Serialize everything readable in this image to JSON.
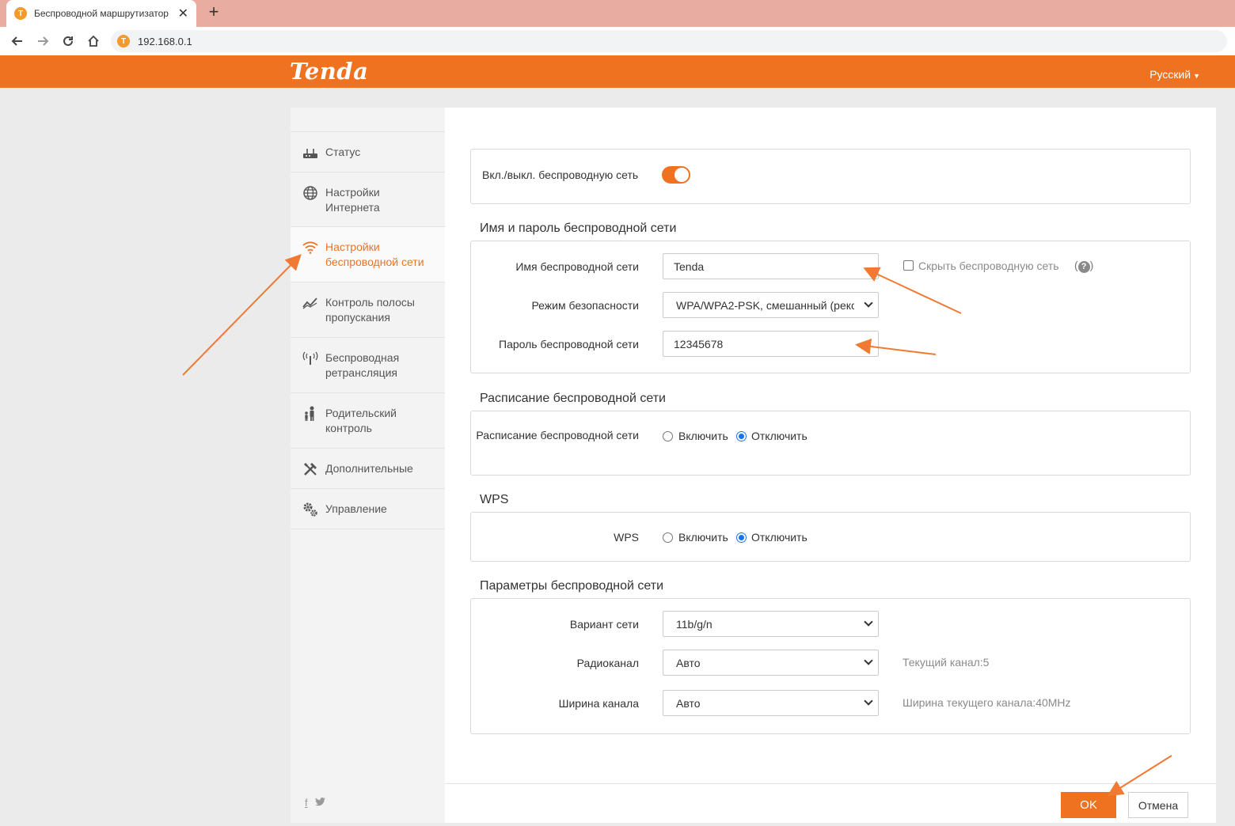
{
  "browser": {
    "tab_title": "Беспроводной маршрутизатор",
    "url": "192.168.0.1",
    "favicon_letter": "T"
  },
  "header": {
    "logo": "Tenda",
    "language": "Русский",
    "accent_color": "#ee7220"
  },
  "sidebar": {
    "items": [
      {
        "label": "Статус",
        "icon": "router-icon",
        "active": false
      },
      {
        "label": "Настройки Интернета",
        "icon": "globe-icon",
        "active": false
      },
      {
        "label": "Настройки беспроводной сети",
        "icon": "wifi-icon",
        "active": true
      },
      {
        "label": "Контроль полосы пропускания",
        "icon": "chart-line-icon",
        "active": false
      },
      {
        "label": "Беспроводная ретрансляция",
        "icon": "antenna-icon",
        "active": false
      },
      {
        "label": "Родительский контроль",
        "icon": "parent-child-icon",
        "active": false
      },
      {
        "label": "Дополнительные",
        "icon": "tools-icon",
        "active": false
      },
      {
        "label": "Управление",
        "icon": "gears-icon",
        "active": false
      }
    ],
    "social": {
      "facebook": "f",
      "twitter": "twitter-icon"
    }
  },
  "wireless_toggle": {
    "label": "Вкл./выкл. беспроводную сеть",
    "enabled": true
  },
  "ssid_section": {
    "title": "Имя и пароль беспроводной сети",
    "ssid_label": "Имя беспроводной сети",
    "ssid_value": "Tenda",
    "hide_label": "Скрыть беспроводную сеть",
    "hide_checked": false,
    "help": "?",
    "security_label": "Режим безопасности",
    "security_value": "WPA/WPA2-PSK, смешанный (рекс",
    "password_label": "Пароль беспроводной сети",
    "password_value": "12345678"
  },
  "schedule_section": {
    "title": "Расписание беспроводной сети",
    "label": "Расписание беспроводной сети",
    "enable": "Включить",
    "disable": "Отключить",
    "selected": "disable"
  },
  "wps_section": {
    "title": "WPS",
    "label": "WPS",
    "enable": "Включить",
    "disable": "Отключить",
    "selected": "disable"
  },
  "params_section": {
    "title": "Параметры беспроводной сети",
    "mode_label": "Вариант сети",
    "mode_value": "11b/g/n",
    "channel_label": "Радиоканал",
    "channel_value": "Авто",
    "channel_hint": "Текущий канал:5",
    "width_label": "Ширина канала",
    "width_value": "Авто",
    "width_hint": "Ширина текущего канала:40MHz"
  },
  "buttons": {
    "ok": "OK",
    "cancel": "Отмена"
  }
}
